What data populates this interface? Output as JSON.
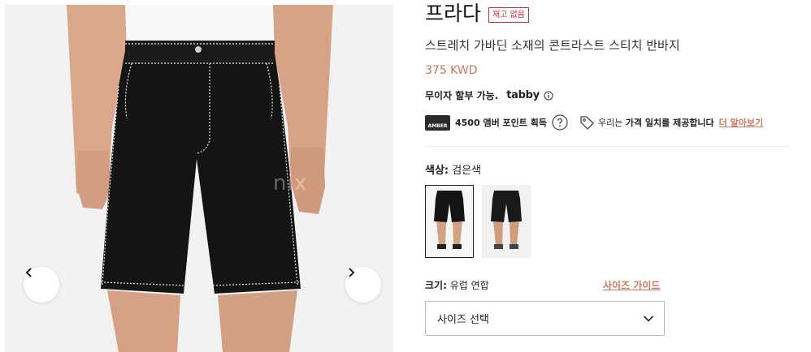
{
  "gallery": {
    "watermark": "nix",
    "prev_icon": "chevron-left-icon",
    "next_icon": "chevron-right-icon"
  },
  "product": {
    "brand": "프라다",
    "stock_badge": "재고 없음",
    "title": "스트레치 가바딘 소재의 콘트라스트 스티치 반바지",
    "price": "375 KWD"
  },
  "installments": {
    "text": "무이자 할부 가능.",
    "provider": "tabby"
  },
  "points": {
    "logo_text": "AMBER",
    "text": "4500 앰버 포인트 획득",
    "price_match_prefix": "우리는 ",
    "price_match_bold": "가격 일치를 제공합니다",
    "learn_more": "더 알아보기"
  },
  "color": {
    "label": "색상:",
    "value": "검은색",
    "swatches": [
      "black",
      "white"
    ]
  },
  "size": {
    "label": "크기:",
    "value": "유럽 연합",
    "guide": "사이즈 가이드",
    "select_placeholder": "사이즈 선택"
  },
  "colors": {
    "accent": "#c8795a",
    "badge": "#c8292f",
    "garment": "#141414",
    "stitch": "#e8e8e8"
  }
}
